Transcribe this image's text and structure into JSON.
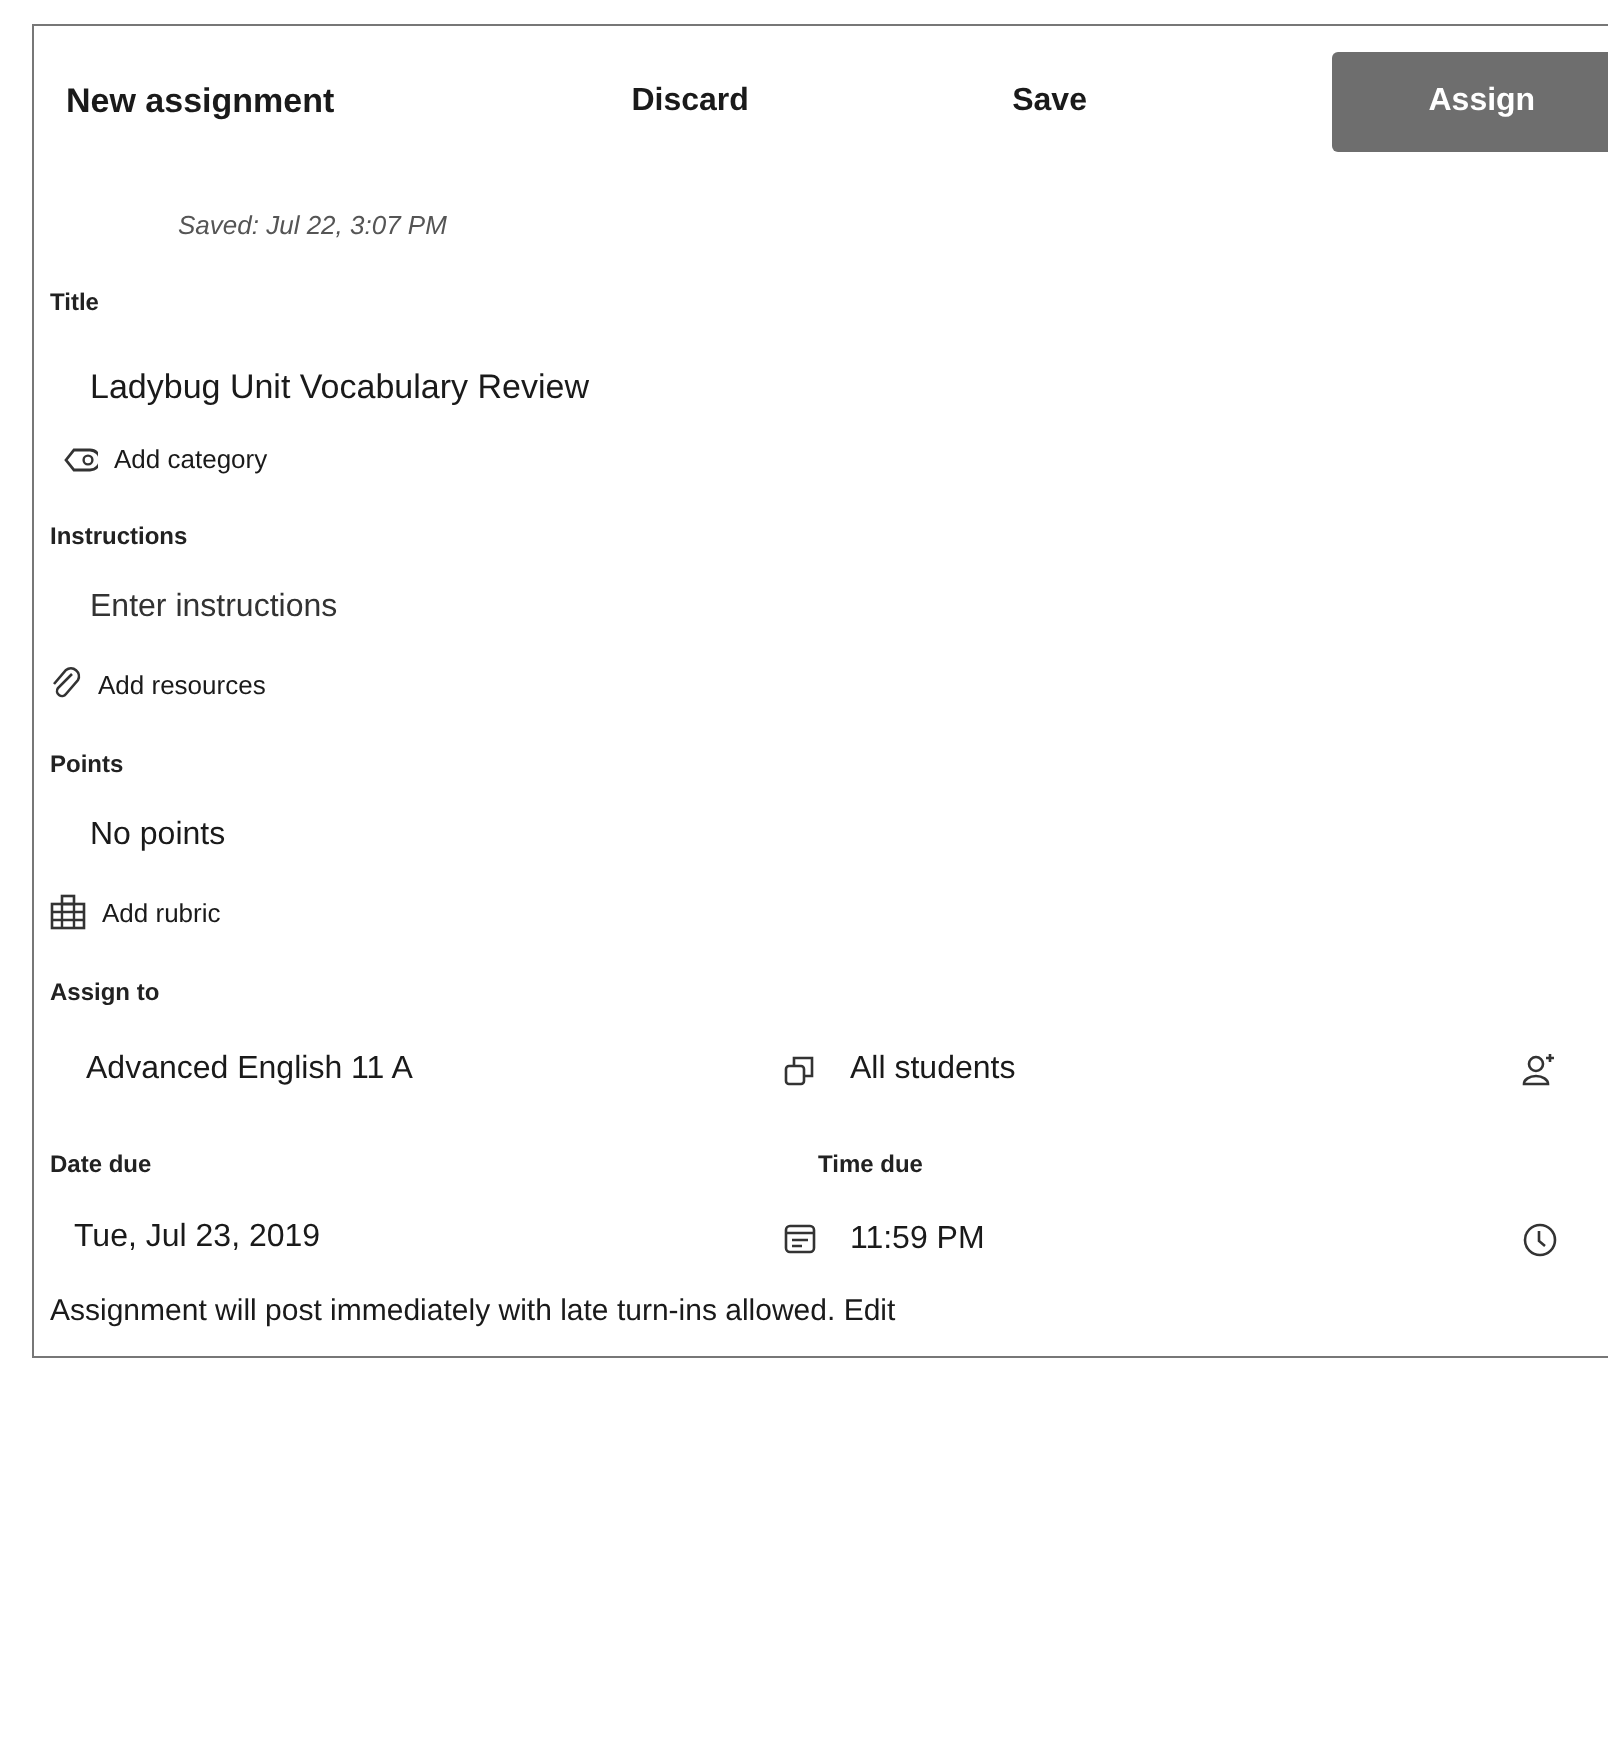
{
  "header": {
    "title": "New assignment",
    "buttons": [
      {
        "label": "Discard",
        "kind": "plain"
      },
      {
        "label": "Save",
        "kind": "plain"
      },
      {
        "label": "Assign",
        "kind": "primary"
      }
    ]
  },
  "saved_status": "Saved: Jul 22, 3:07 PM",
  "title": {
    "label": "Title",
    "value": "Ladybug Unit Vocabulary Review"
  },
  "add_category": "Add category",
  "instructions": {
    "label": "Instructions",
    "placeholder": "Enter instructions"
  },
  "add_resources": "Add resources",
  "points": {
    "label": "Points",
    "value": "No points"
  },
  "add_rubric": "Add rubric",
  "assign_to": {
    "label": "Assign to",
    "class": "Advanced English 11 A",
    "students": "All students"
  },
  "date_due": {
    "label": "Date due",
    "value": "Tue, Jul 23, 2019"
  },
  "time_due": {
    "label": "Time due",
    "value": "11:59 PM"
  },
  "footer": {
    "text": "Assignment will post immediately with late turn-ins allowed.",
    "link": "Edit"
  }
}
